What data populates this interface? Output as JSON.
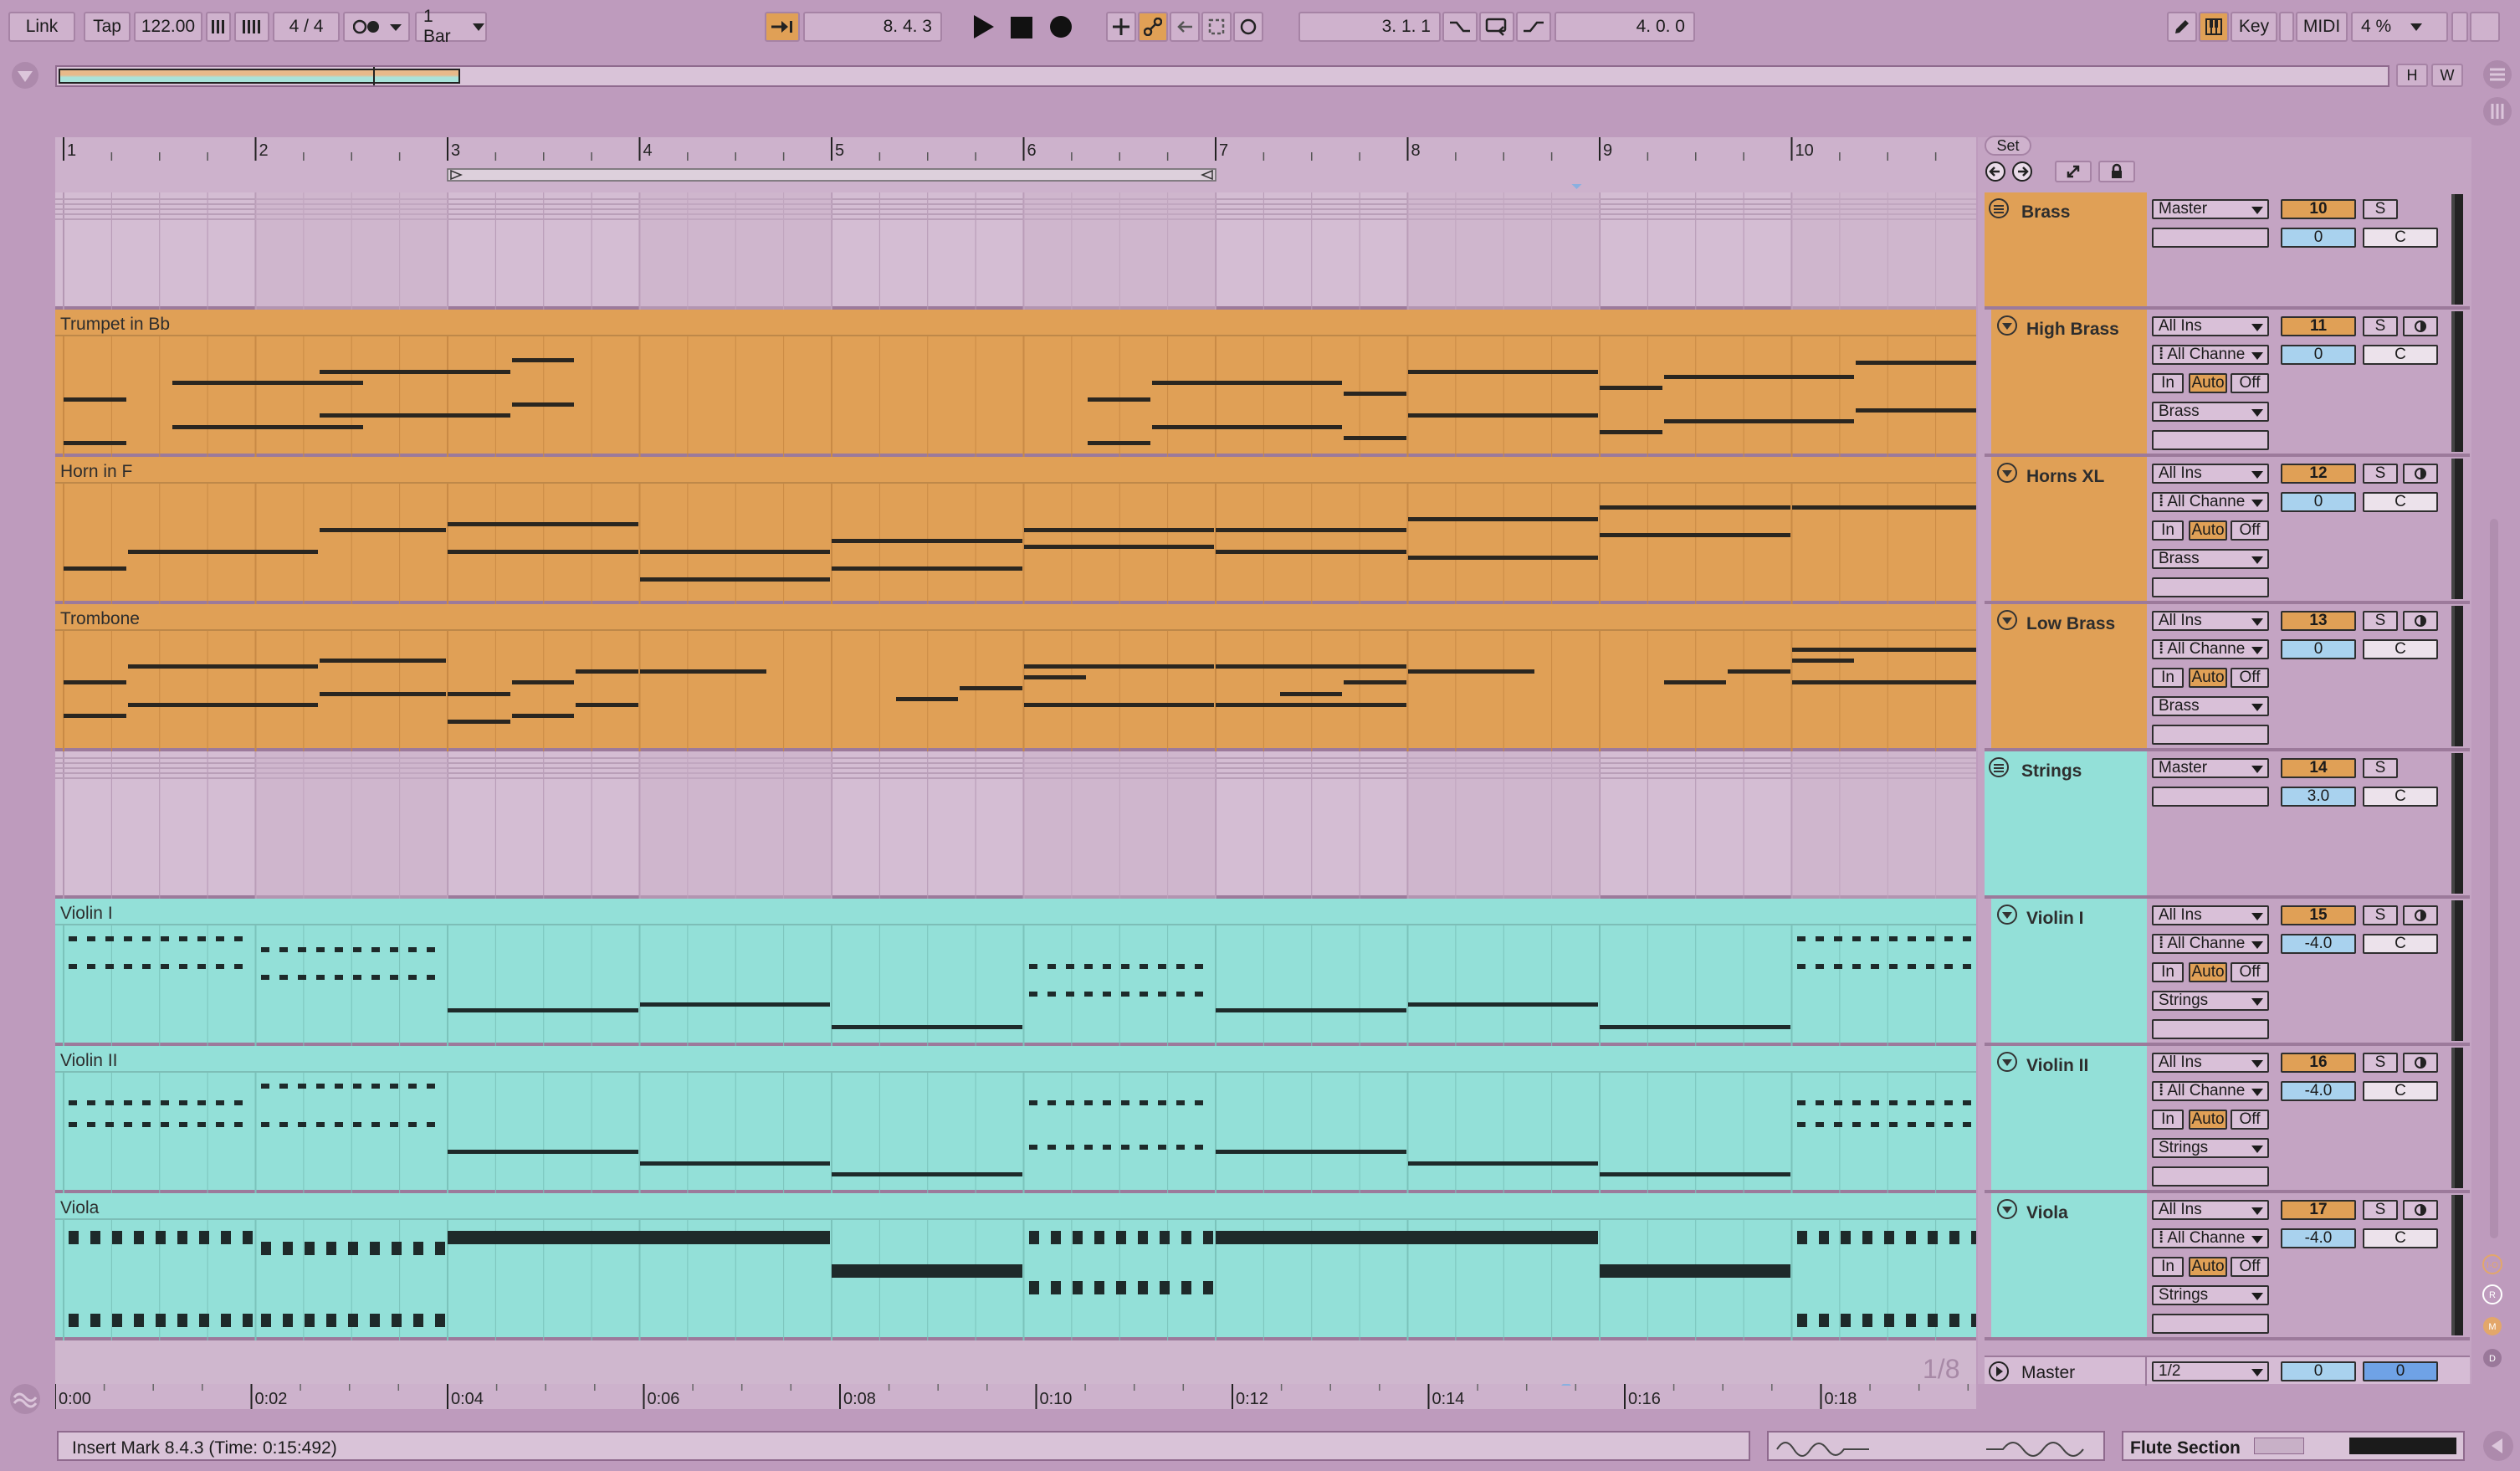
{
  "transport": {
    "link": "Link",
    "tap": "Tap",
    "tempo": "122.00",
    "signature": "4 / 4",
    "quantize": "1 Bar",
    "position": "8.  4.  3",
    "loop_start": "3.  1.  1",
    "loop_length": "4.  0.  0",
    "key": "Key",
    "midi": "MIDI",
    "cpu": "4 %"
  },
  "ruler": {
    "bars": [
      "1",
      "2",
      "3",
      "4",
      "5",
      "6",
      "7",
      "8",
      "9",
      "10"
    ],
    "times": [
      "0:00",
      "0:02",
      "0:04",
      "0:06",
      "0:08",
      "0:10",
      "0:12",
      "0:14",
      "0:16",
      "0:18"
    ],
    "grid_quant": "1/8"
  },
  "side": {
    "set": "Set",
    "overview_h": "H",
    "overview_w": "W"
  },
  "tracks": [
    {
      "name": "Brass",
      "title": "",
      "kind": "group",
      "color": "#e0a056",
      "output": "Master",
      "num": "10",
      "vol": "0",
      "pan": "C",
      "solo": "S"
    },
    {
      "name": "High Brass",
      "title": "Trumpet in Bb",
      "kind": "midi",
      "color": "#e0a056",
      "input": "All Ins",
      "channel": "All Channe",
      "monitor": [
        "In",
        "Auto",
        "Off"
      ],
      "output": "Brass",
      "num": "11",
      "vol": "0",
      "pan": "C",
      "solo": "S"
    },
    {
      "name": "Horns XL",
      "title": "Horn in F",
      "kind": "midi",
      "color": "#e0a056",
      "input": "All Ins",
      "channel": "All Channe",
      "monitor": [
        "In",
        "Auto",
        "Off"
      ],
      "output": "Brass",
      "num": "12",
      "vol": "0",
      "pan": "C",
      "solo": "S"
    },
    {
      "name": "Low Brass",
      "title": "Trombone",
      "kind": "midi",
      "color": "#e0a056",
      "input": "All Ins",
      "channel": "All Channe",
      "monitor": [
        "In",
        "Auto",
        "Off"
      ],
      "output": "Brass",
      "num": "13",
      "vol": "0",
      "pan": "C",
      "solo": "S"
    },
    {
      "name": "Strings",
      "title": "",
      "kind": "group",
      "color": "#93e0d8",
      "output": "Master",
      "num": "14",
      "vol": "3.0",
      "pan": "C",
      "solo": "S"
    },
    {
      "name": "Violin I",
      "title": "Violin I",
      "kind": "midi",
      "color": "#93e0d8",
      "input": "All Ins",
      "channel": "All Channe",
      "monitor": [
        "In",
        "Auto",
        "Off"
      ],
      "output": "Strings",
      "num": "15",
      "vol": "-4.0",
      "pan": "C",
      "solo": "S"
    },
    {
      "name": "Violin II",
      "title": "Violin II",
      "kind": "midi",
      "color": "#93e0d8",
      "input": "All Ins",
      "channel": "All Channe",
      "monitor": [
        "In",
        "Auto",
        "Off"
      ],
      "output": "Strings",
      "num": "16",
      "vol": "-4.0",
      "pan": "C",
      "solo": "S"
    },
    {
      "name": "Viola",
      "title": "Viola",
      "kind": "midi",
      "color": "#93e0d8",
      "input": "All Ins",
      "channel": "All Channe",
      "monitor": [
        "In",
        "Auto",
        "Off"
      ],
      "output": "Strings",
      "num": "17",
      "vol": "-4.0",
      "pan": "C",
      "solo": "S"
    }
  ],
  "master": {
    "name": "Master",
    "output": "1/2",
    "vol": "0",
    "pan": "0"
  },
  "status": {
    "message": "Insert Mark 8.4.3 (Time: 0:15:492)",
    "section": "Flute Section"
  },
  "colors": {
    "background": "#be9bbd",
    "brass": "#e0a056",
    "strings": "#93e0d8",
    "panel": "#d6bcd5"
  }
}
